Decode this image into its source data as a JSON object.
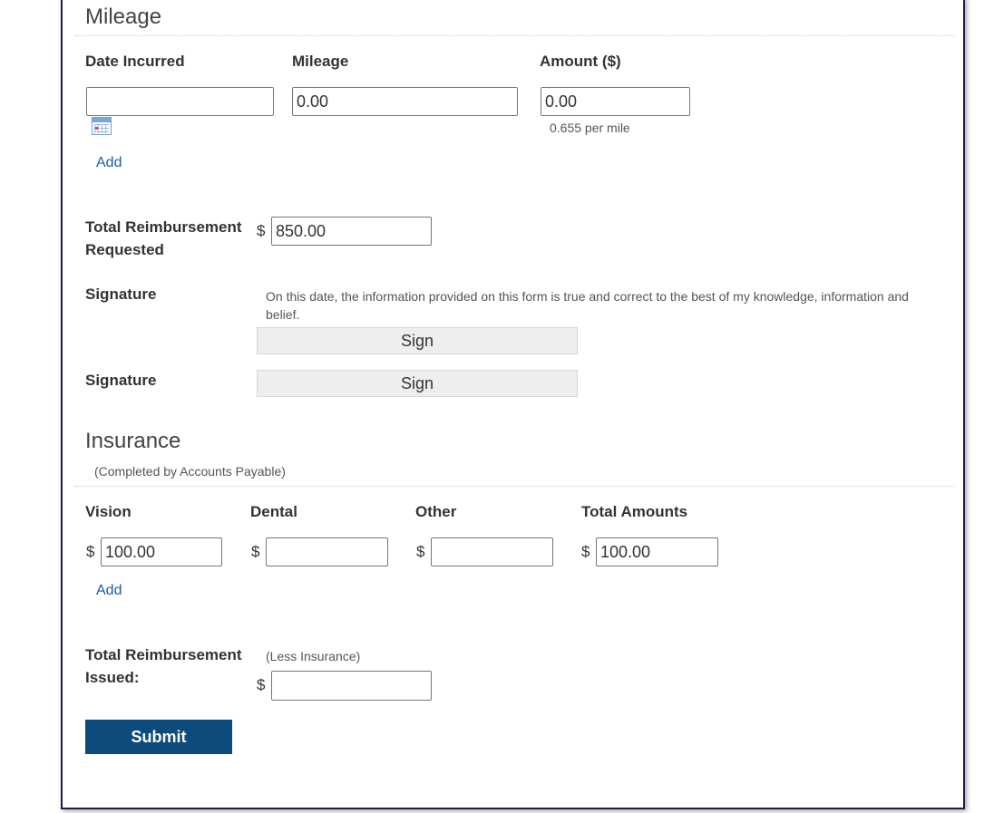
{
  "mileage": {
    "title": "Mileage",
    "col_date": "Date Incurred",
    "col_mileage": "Mileage",
    "col_amount": "Amount ($)",
    "date_value": "",
    "mileage_value": "0.00",
    "amount_value": "0.00",
    "rate_note": "0.655 per mile",
    "add_label": "Add"
  },
  "total_requested": {
    "label_line1": "Total Reimbursement",
    "label_line2": "Requested",
    "currency": "$",
    "value": "850.00"
  },
  "signatures": {
    "label": "Signature",
    "statement": "On this date, the information provided on this form is true and correct to the best of my knowledge, information and",
    "statement_cont": "belief.",
    "sign_label": "Sign",
    "label2": "Signature",
    "sign_label2": "Sign"
  },
  "insurance": {
    "title": "Insurance",
    "subtitle": "(Completed by Accounts Payable)",
    "col_vision": "Vision",
    "col_dental": "Dental",
    "col_other": "Other",
    "col_total": "Total Amounts",
    "currency": "$",
    "vision_value": "100.00",
    "dental_value": "",
    "other_value": "",
    "total_value": "100.00",
    "add_label": "Add"
  },
  "total_issued": {
    "label_line1": "Total Reimbursement",
    "label_line2": "Issued:",
    "note": "(Less Insurance)",
    "currency": "$",
    "value": ""
  },
  "submit_label": "Submit"
}
